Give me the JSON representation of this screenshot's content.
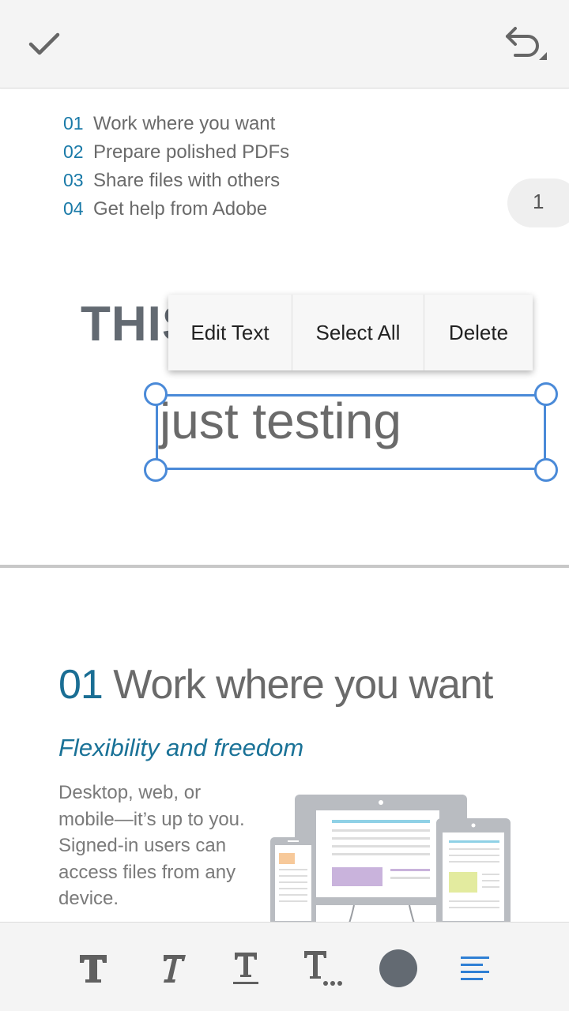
{
  "toolbar": {
    "done_icon": "check-icon",
    "undo_icon": "undo-icon"
  },
  "toc": [
    {
      "num": "01",
      "text": "Work where you want"
    },
    {
      "num": "02",
      "text": "Prepare polished PDFs"
    },
    {
      "num": "03",
      "text": "Share files with others"
    },
    {
      "num": "04",
      "text": "Get help from Adobe"
    }
  ],
  "page_indicator": "1",
  "heading_visible": "THIS",
  "context_menu": {
    "edit_text": "Edit Text",
    "select_all": "Select All",
    "delete": "Delete"
  },
  "selected_text": "just testing",
  "section": {
    "number": "01",
    "title": "Work where you want",
    "subtitle": "Flexibility and freedom",
    "body_lines": [
      "Desktop, web, or",
      "mobile—it’s up to you.",
      "Signed-in users can",
      "access files from any",
      "device."
    ]
  },
  "bottom_tools": [
    "bold-text-icon",
    "italic-text-icon",
    "underline-text-icon",
    "more-text-styles-icon",
    "color-swatch-icon",
    "align-left-icon"
  ],
  "colors": {
    "accent": "#4a8ad8",
    "teal": "#1a7aa8",
    "swatch": "#636a72"
  }
}
